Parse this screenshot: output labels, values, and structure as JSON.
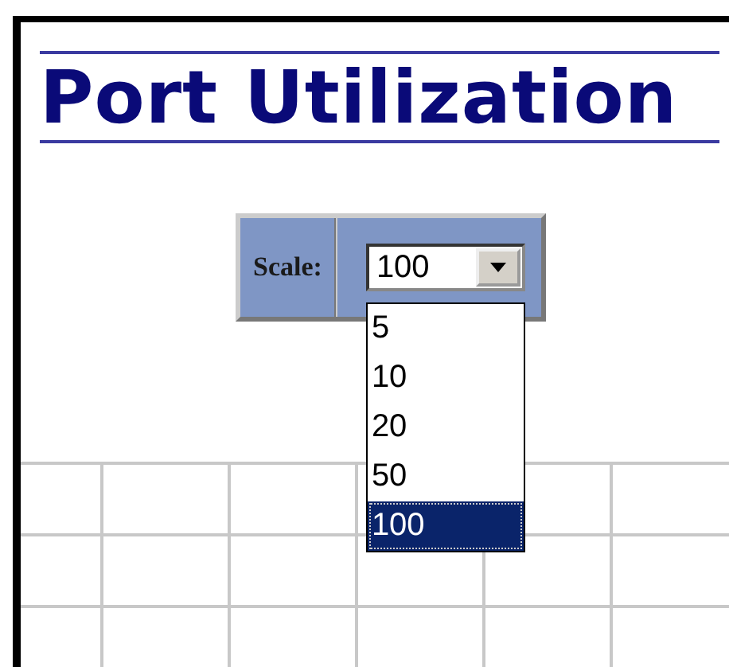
{
  "title": "Port Utilization",
  "scale": {
    "label": "Scale:",
    "value": "100",
    "expanded": true,
    "options": [
      {
        "label": "5",
        "selected": false
      },
      {
        "label": "10",
        "selected": false
      },
      {
        "label": "20",
        "selected": false
      },
      {
        "label": "50",
        "selected": false
      },
      {
        "label": "100",
        "selected": true
      }
    ]
  }
}
